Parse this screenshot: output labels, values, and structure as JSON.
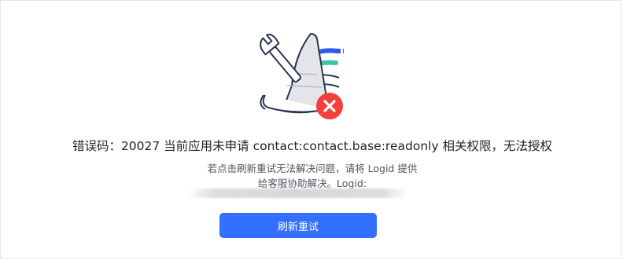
{
  "error": {
    "message": "错误码：20027 当前应用未申请 contact:contact.base:readonly 相关权限，无法授权",
    "hint_line1": "若点击刷新重试无法解决问题，请将 Logid 提供",
    "hint_line2": "给客服协助解决。Logid:"
  },
  "actions": {
    "retry_label": "刷新重试"
  },
  "colors": {
    "primary": "#3370ff",
    "error": "#f53f3f",
    "accent_blue": "#2f5bea",
    "accent_green": "#3ec4a5"
  }
}
